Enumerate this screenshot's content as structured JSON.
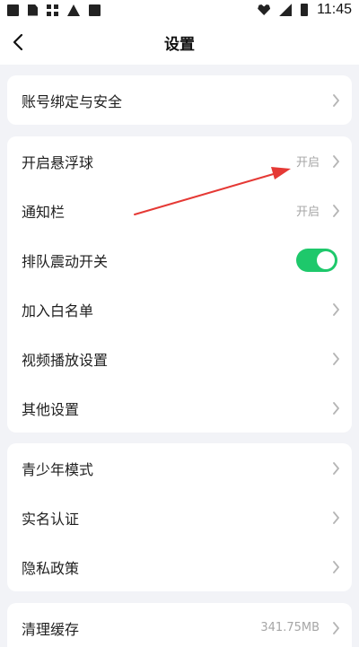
{
  "statusbar": {
    "time": "11:45"
  },
  "header": {
    "title": "设置"
  },
  "card1": {
    "items": [
      {
        "label": "账号绑定与安全"
      }
    ]
  },
  "card2": {
    "items": [
      {
        "label": "开启悬浮球",
        "value": "开启"
      },
      {
        "label": "通知栏",
        "value": "开启"
      },
      {
        "label": "排队震动开关",
        "toggle": true
      },
      {
        "label": "加入白名单"
      },
      {
        "label": "视频播放设置"
      },
      {
        "label": "其他设置"
      }
    ]
  },
  "card3": {
    "items": [
      {
        "label": "青少年模式"
      },
      {
        "label": "实名认证"
      },
      {
        "label": "隐私政策"
      }
    ]
  },
  "card4": {
    "items": [
      {
        "label": "清理缓存",
        "value": "341.75MB"
      }
    ]
  },
  "colors": {
    "accent_toggle": "#1ec86b",
    "annotation_arrow": "#e53935",
    "background": "#f2f3f7"
  },
  "icons": {
    "back": "chevron-left-icon",
    "row_chevron": "chevron-right-icon"
  }
}
